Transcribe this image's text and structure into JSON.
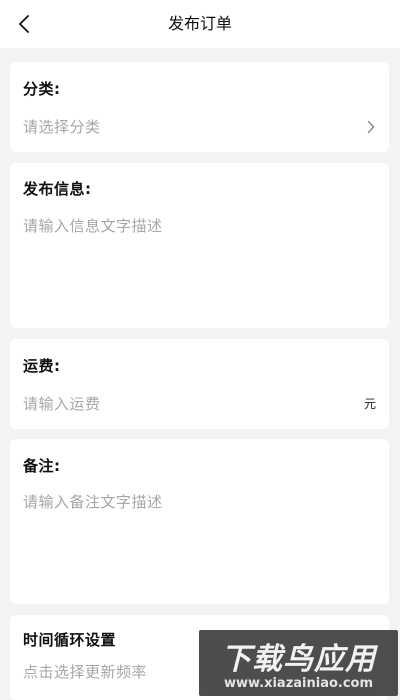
{
  "header": {
    "title": "发布订单",
    "back_icon": "chevron-left-icon"
  },
  "category": {
    "label": "分类:",
    "placeholder": "请选择分类",
    "chevron_icon": "chevron-right-icon"
  },
  "info": {
    "label": "发布信息:",
    "placeholder": "请输入信息文字描述"
  },
  "freight": {
    "label": "运费:",
    "placeholder": "请输入运费",
    "unit": "元"
  },
  "remark": {
    "label": "备注:",
    "placeholder": "请输入备注文字描述"
  },
  "schedule": {
    "label": "时间循环设置",
    "placeholder": "点击选择更新频率"
  },
  "watermark": {
    "title": "下载鸟应用",
    "url": "www.xiazainiao.com"
  }
}
